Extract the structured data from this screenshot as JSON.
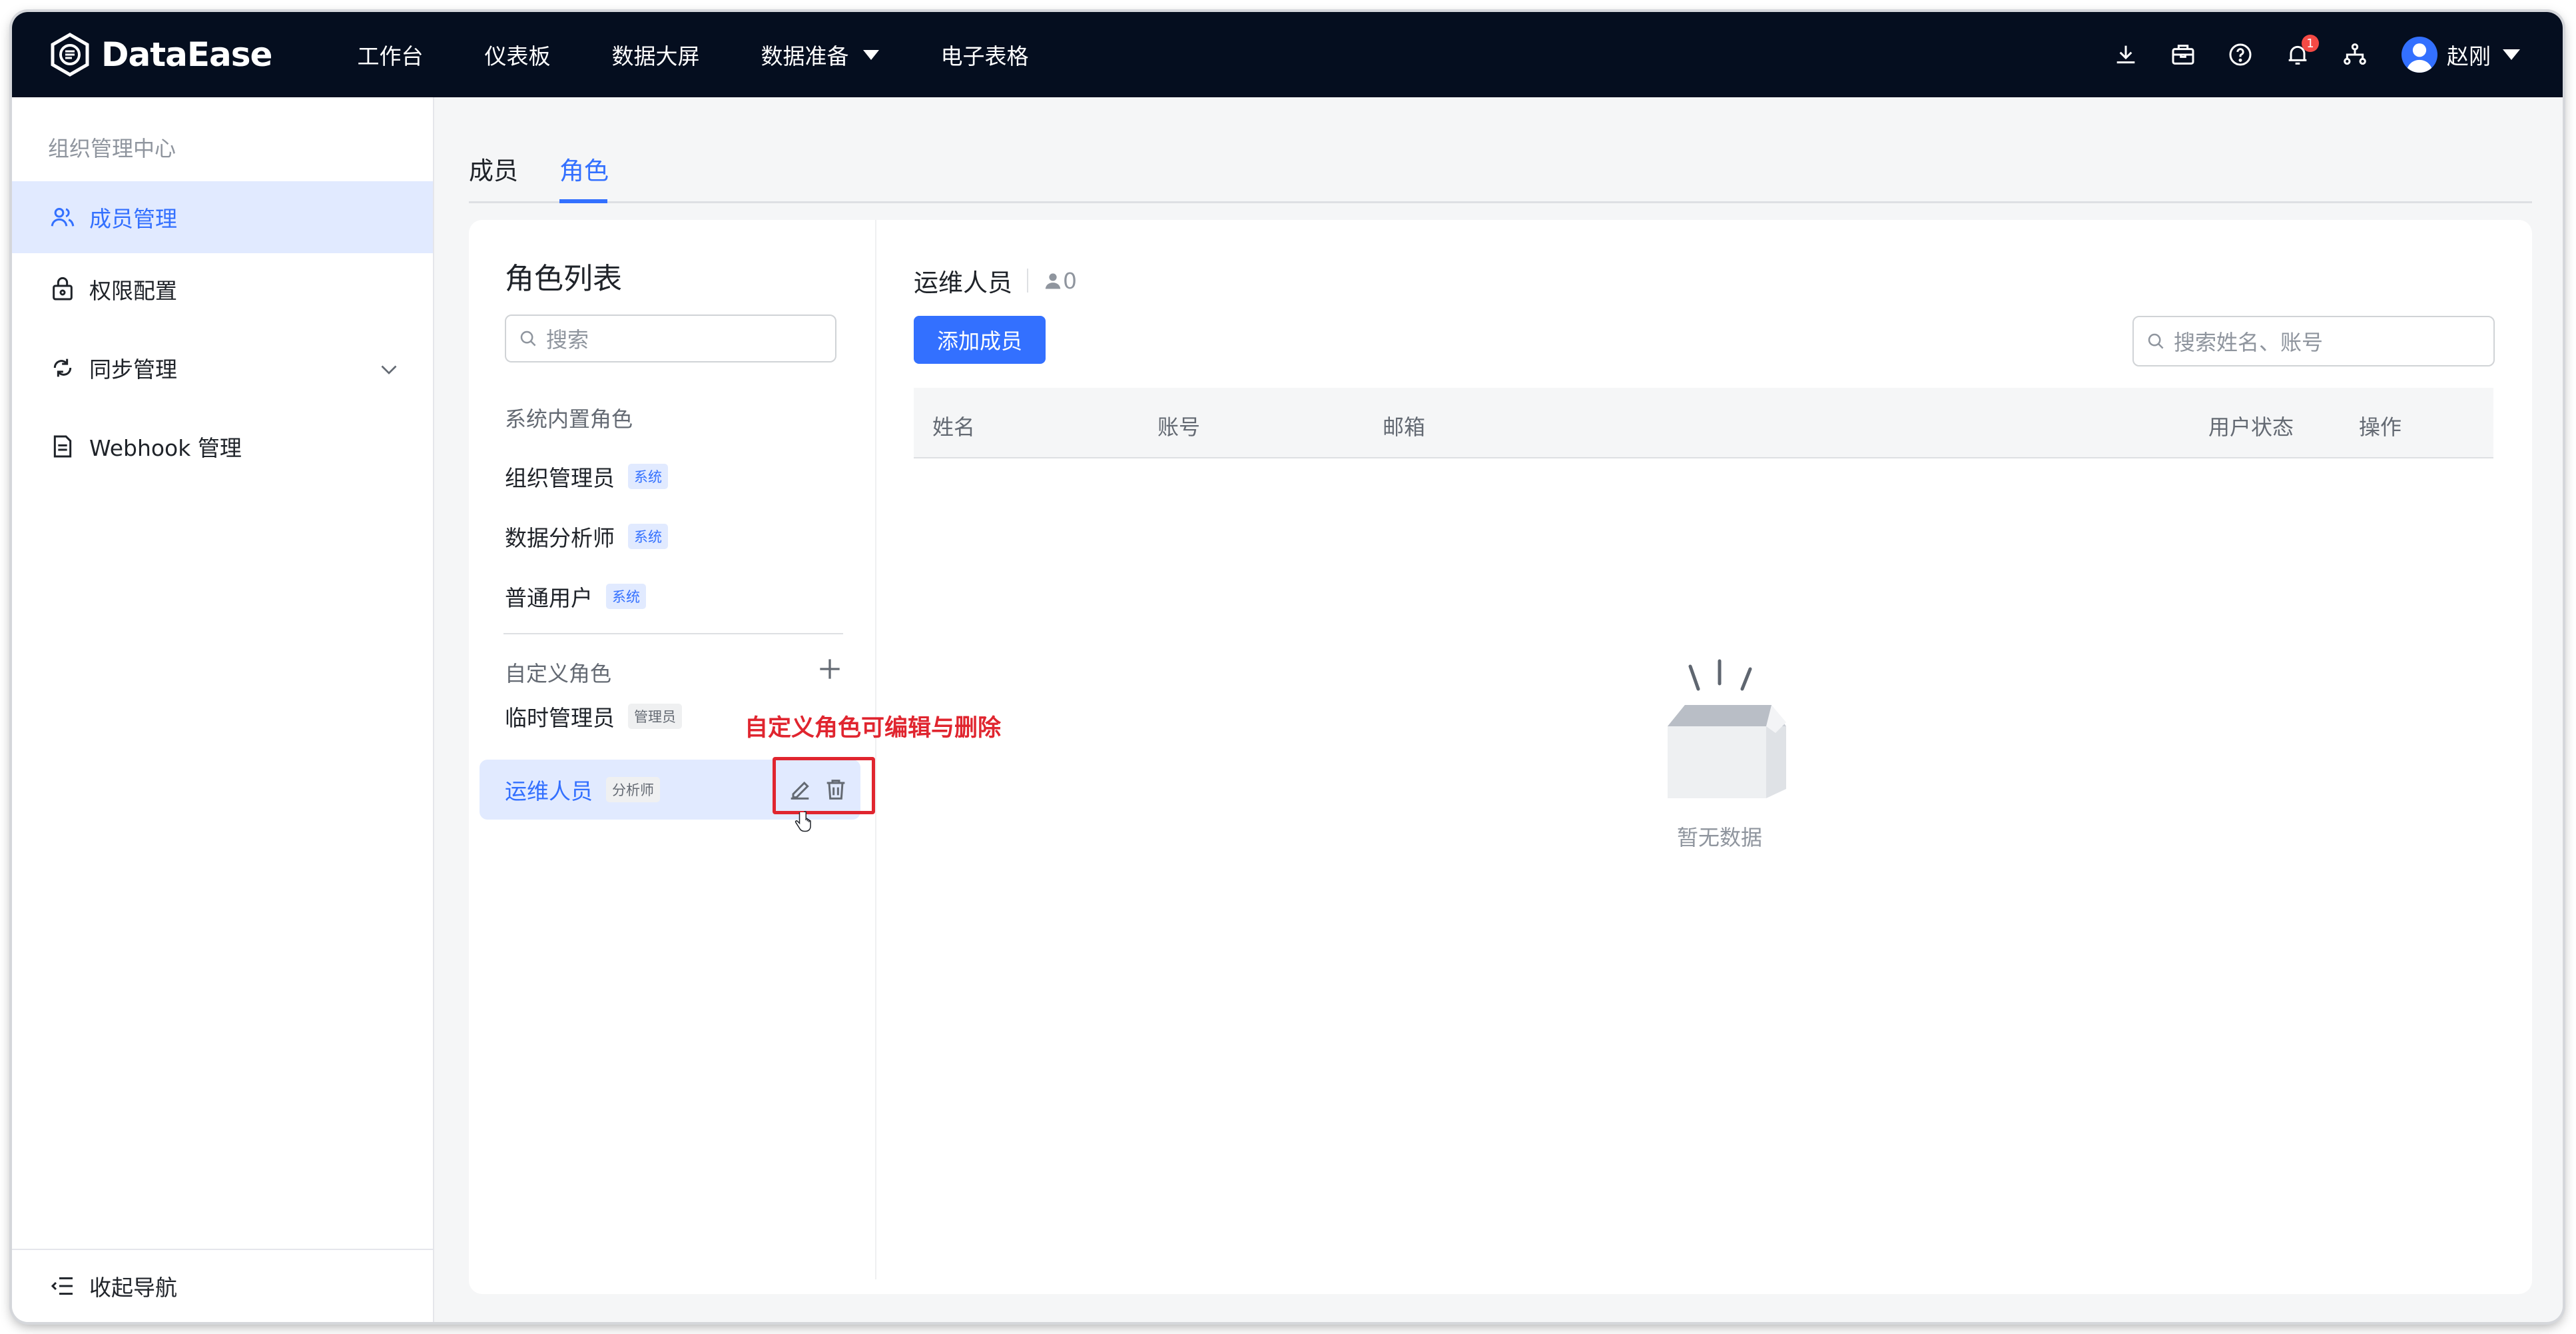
{
  "brand": {
    "name": "DataEase"
  },
  "topnav": {
    "items": [
      {
        "label": "工作台"
      },
      {
        "label": "仪表板"
      },
      {
        "label": "数据大屏"
      },
      {
        "label": "数据准备"
      },
      {
        "label": "电子表格"
      }
    ],
    "notification_count": "1",
    "user_name": "赵刚"
  },
  "sidebar": {
    "title": "组织管理中心",
    "items": [
      {
        "label": "成员管理",
        "icon": "users-icon",
        "active": true
      },
      {
        "label": "权限配置",
        "icon": "lock-icon"
      },
      {
        "label": "同步管理",
        "icon": "sync-icon"
      },
      {
        "label": "Webhook 管理",
        "icon": "document-icon"
      }
    ],
    "collapse_label": "收起导航"
  },
  "tabs": {
    "members": "成员",
    "roles": "角色",
    "active": "roles"
  },
  "role_list": {
    "title": "角色列表",
    "search_placeholder": "搜索",
    "system_group_label": "系统内置角色",
    "system_roles": [
      {
        "name": "组织管理员",
        "tag": "系统"
      },
      {
        "name": "数据分析师",
        "tag": "系统"
      },
      {
        "name": "普通用户",
        "tag": "系统"
      }
    ],
    "custom_group_label": "自定义角色",
    "custom_roles": [
      {
        "name": "临时管理员",
        "tag": "管理员"
      },
      {
        "name": "运维人员",
        "tag": "分析师",
        "active": true
      }
    ],
    "annotation": "自定义角色可编辑与删除"
  },
  "detail": {
    "role_name": "运维人员",
    "member_count": "0",
    "add_button": "添加成员",
    "search_placeholder": "搜索姓名、账号",
    "columns": [
      "姓名",
      "账号",
      "邮箱",
      "用户状态",
      "操作"
    ],
    "empty_text": "暂无数据"
  },
  "colors": {
    "primary": "#3370ff",
    "topbar": "#050e1f",
    "annotation": "#e0252f"
  }
}
